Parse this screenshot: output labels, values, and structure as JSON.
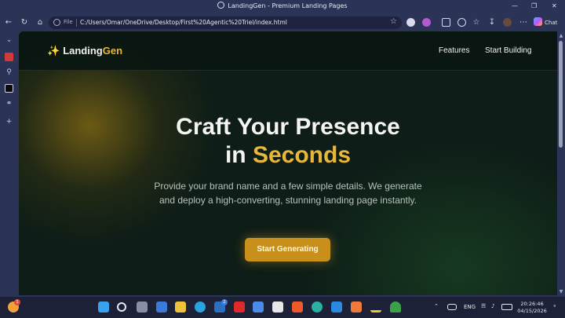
{
  "window": {
    "title": "LandingGen - Premium Landing Pages"
  },
  "browser": {
    "scheme_label": "File",
    "url": "C:/Users/Omar/OneDrive/Desktop/First%20Agentic%20Triel/index.html",
    "chat_label": "Chat"
  },
  "site": {
    "logo_text": "Landing",
    "logo_accent": "Gen",
    "nav": {
      "features": "Features",
      "start_building": "Start Building"
    },
    "hero": {
      "title_line1": "Craft Your Presence",
      "title_line2_prefix": "in ",
      "title_line2_accent": "Seconds",
      "subtitle": "Provide your brand name and a few simple details. We generate and deploy a high-converting, stunning landing page instantly.",
      "cta_label": "Start Generating"
    }
  },
  "taskbar": {
    "language": "ENG",
    "time": "20:26:46",
    "date": "04/15/2026",
    "start_badge": "1",
    "linkedin_badge": "2"
  },
  "colors": {
    "accent_gold": "#e8b73a",
    "cta": "#c8901a",
    "page_bg": "#0e1d17",
    "chrome_bg": "#2b3356"
  }
}
